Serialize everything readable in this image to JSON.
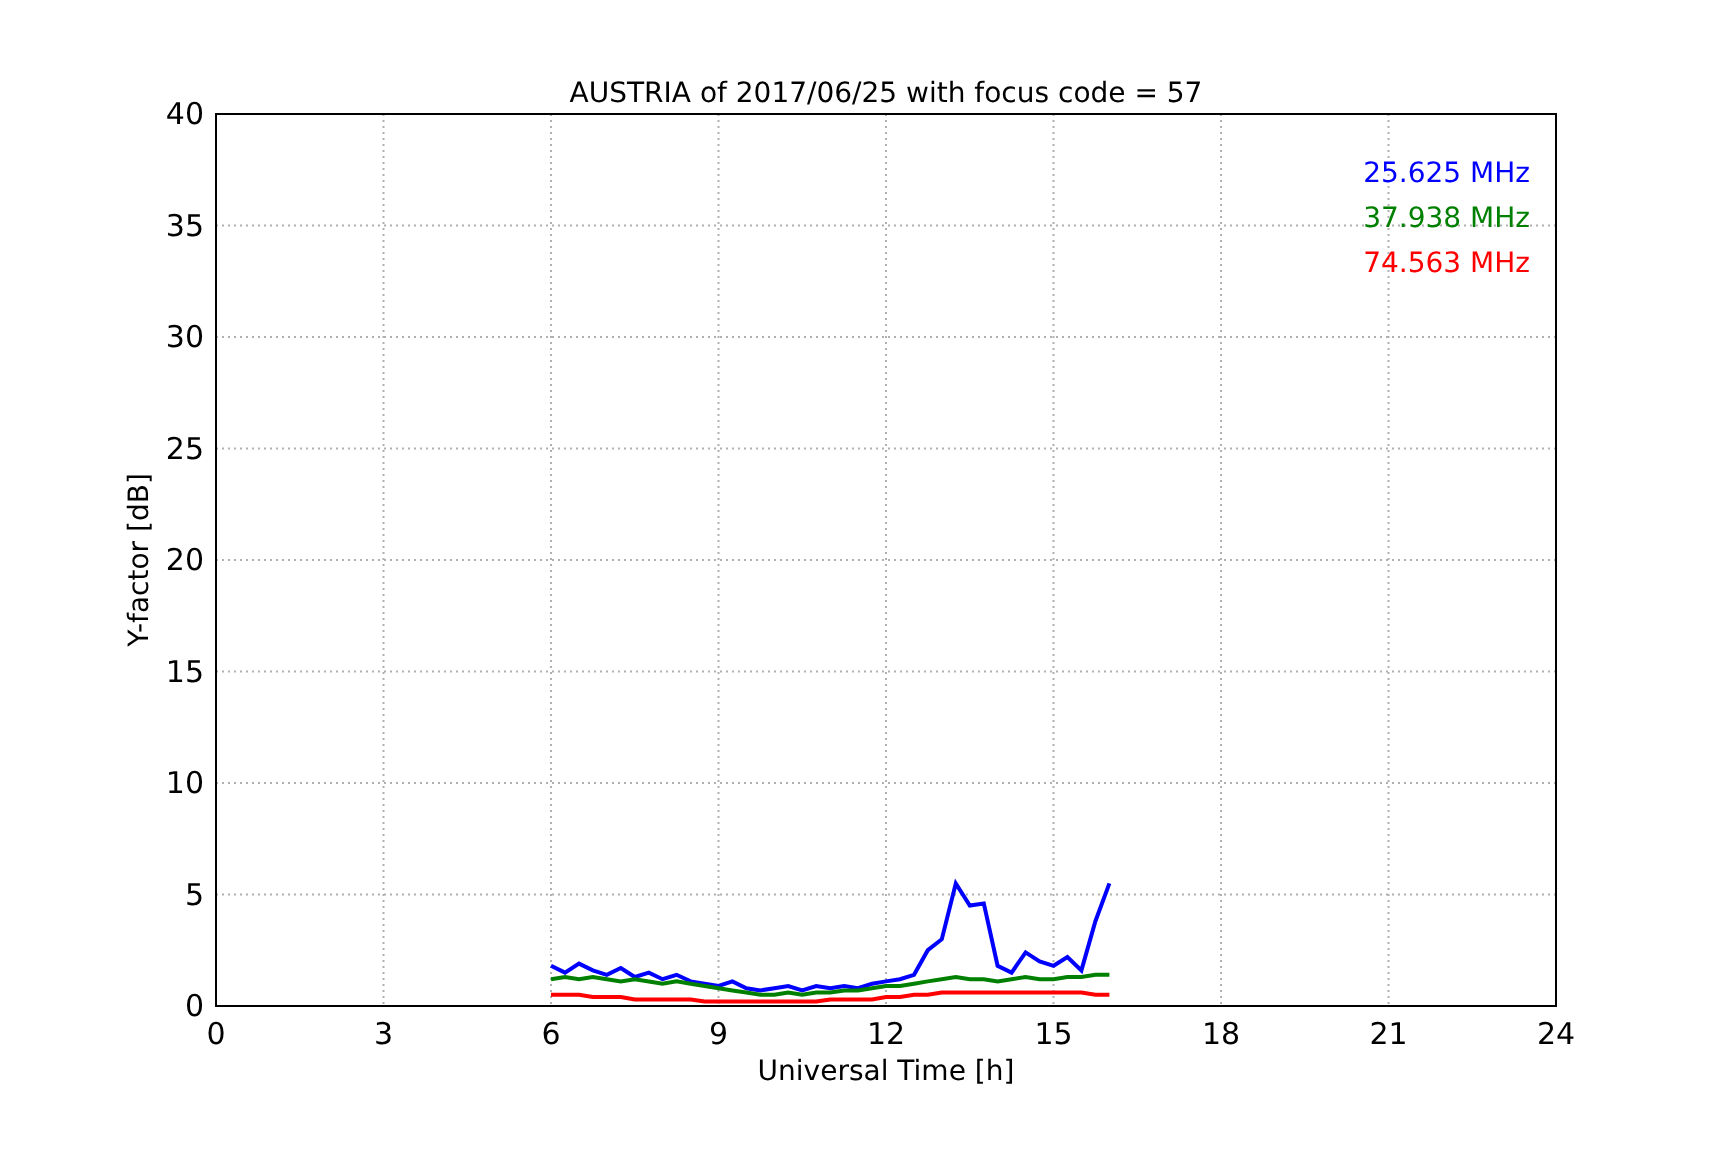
{
  "chart_data": {
    "type": "line",
    "title": "AUSTRIA of 2017/06/25 with focus code = 57",
    "xlabel": "Universal Time [h]",
    "ylabel": "Y-factor [dB]",
    "x": [
      6,
      6.25,
      6.5,
      6.75,
      7,
      7.25,
      7.5,
      7.75,
      8,
      8.25,
      8.5,
      8.75,
      9,
      9.25,
      9.5,
      9.75,
      10,
      10.25,
      10.5,
      10.75,
      11,
      11.25,
      11.5,
      11.75,
      12,
      12.25,
      12.5,
      12.75,
      13,
      13.25,
      13.5,
      13.75,
      14,
      14.25,
      14.5,
      14.75,
      15,
      15.25,
      15.5,
      15.75,
      16
    ],
    "series": [
      {
        "name": "25.625 MHz",
        "color": "#0000ff",
        "values": [
          1.8,
          1.5,
          1.9,
          1.6,
          1.4,
          1.7,
          1.3,
          1.5,
          1.2,
          1.4,
          1.1,
          1.0,
          0.9,
          1.1,
          0.8,
          0.7,
          0.8,
          0.9,
          0.7,
          0.9,
          0.8,
          0.9,
          0.8,
          1.0,
          1.1,
          1.2,
          1.4,
          2.5,
          3.0,
          5.5,
          4.5,
          4.6,
          1.8,
          1.5,
          2.4,
          2.0,
          1.8,
          2.2,
          1.6,
          3.8,
          5.5
        ]
      },
      {
        "name": "37.938 MHz",
        "color": "#008000",
        "values": [
          1.2,
          1.3,
          1.2,
          1.3,
          1.2,
          1.1,
          1.2,
          1.1,
          1.0,
          1.1,
          1.0,
          0.9,
          0.8,
          0.7,
          0.6,
          0.5,
          0.5,
          0.6,
          0.5,
          0.6,
          0.6,
          0.7,
          0.7,
          0.8,
          0.9,
          0.9,
          1.0,
          1.1,
          1.2,
          1.3,
          1.2,
          1.2,
          1.1,
          1.2,
          1.3,
          1.2,
          1.2,
          1.3,
          1.3,
          1.4,
          1.4
        ]
      },
      {
        "name": "74.563 MHz",
        "color": "#ff0000",
        "values": [
          0.5,
          0.5,
          0.5,
          0.4,
          0.4,
          0.4,
          0.3,
          0.3,
          0.3,
          0.3,
          0.3,
          0.2,
          0.2,
          0.2,
          0.2,
          0.2,
          0.2,
          0.2,
          0.2,
          0.2,
          0.3,
          0.3,
          0.3,
          0.3,
          0.4,
          0.4,
          0.5,
          0.5,
          0.6,
          0.6,
          0.6,
          0.6,
          0.6,
          0.6,
          0.6,
          0.6,
          0.6,
          0.6,
          0.6,
          0.5,
          0.5
        ]
      }
    ],
    "xlim": [
      0,
      24
    ],
    "ylim": [
      0,
      40
    ],
    "xticks": [
      0,
      3,
      6,
      9,
      12,
      15,
      18,
      21,
      24
    ],
    "yticks": [
      0,
      5,
      10,
      15,
      20,
      25,
      30,
      35,
      40
    ],
    "grid": true
  }
}
